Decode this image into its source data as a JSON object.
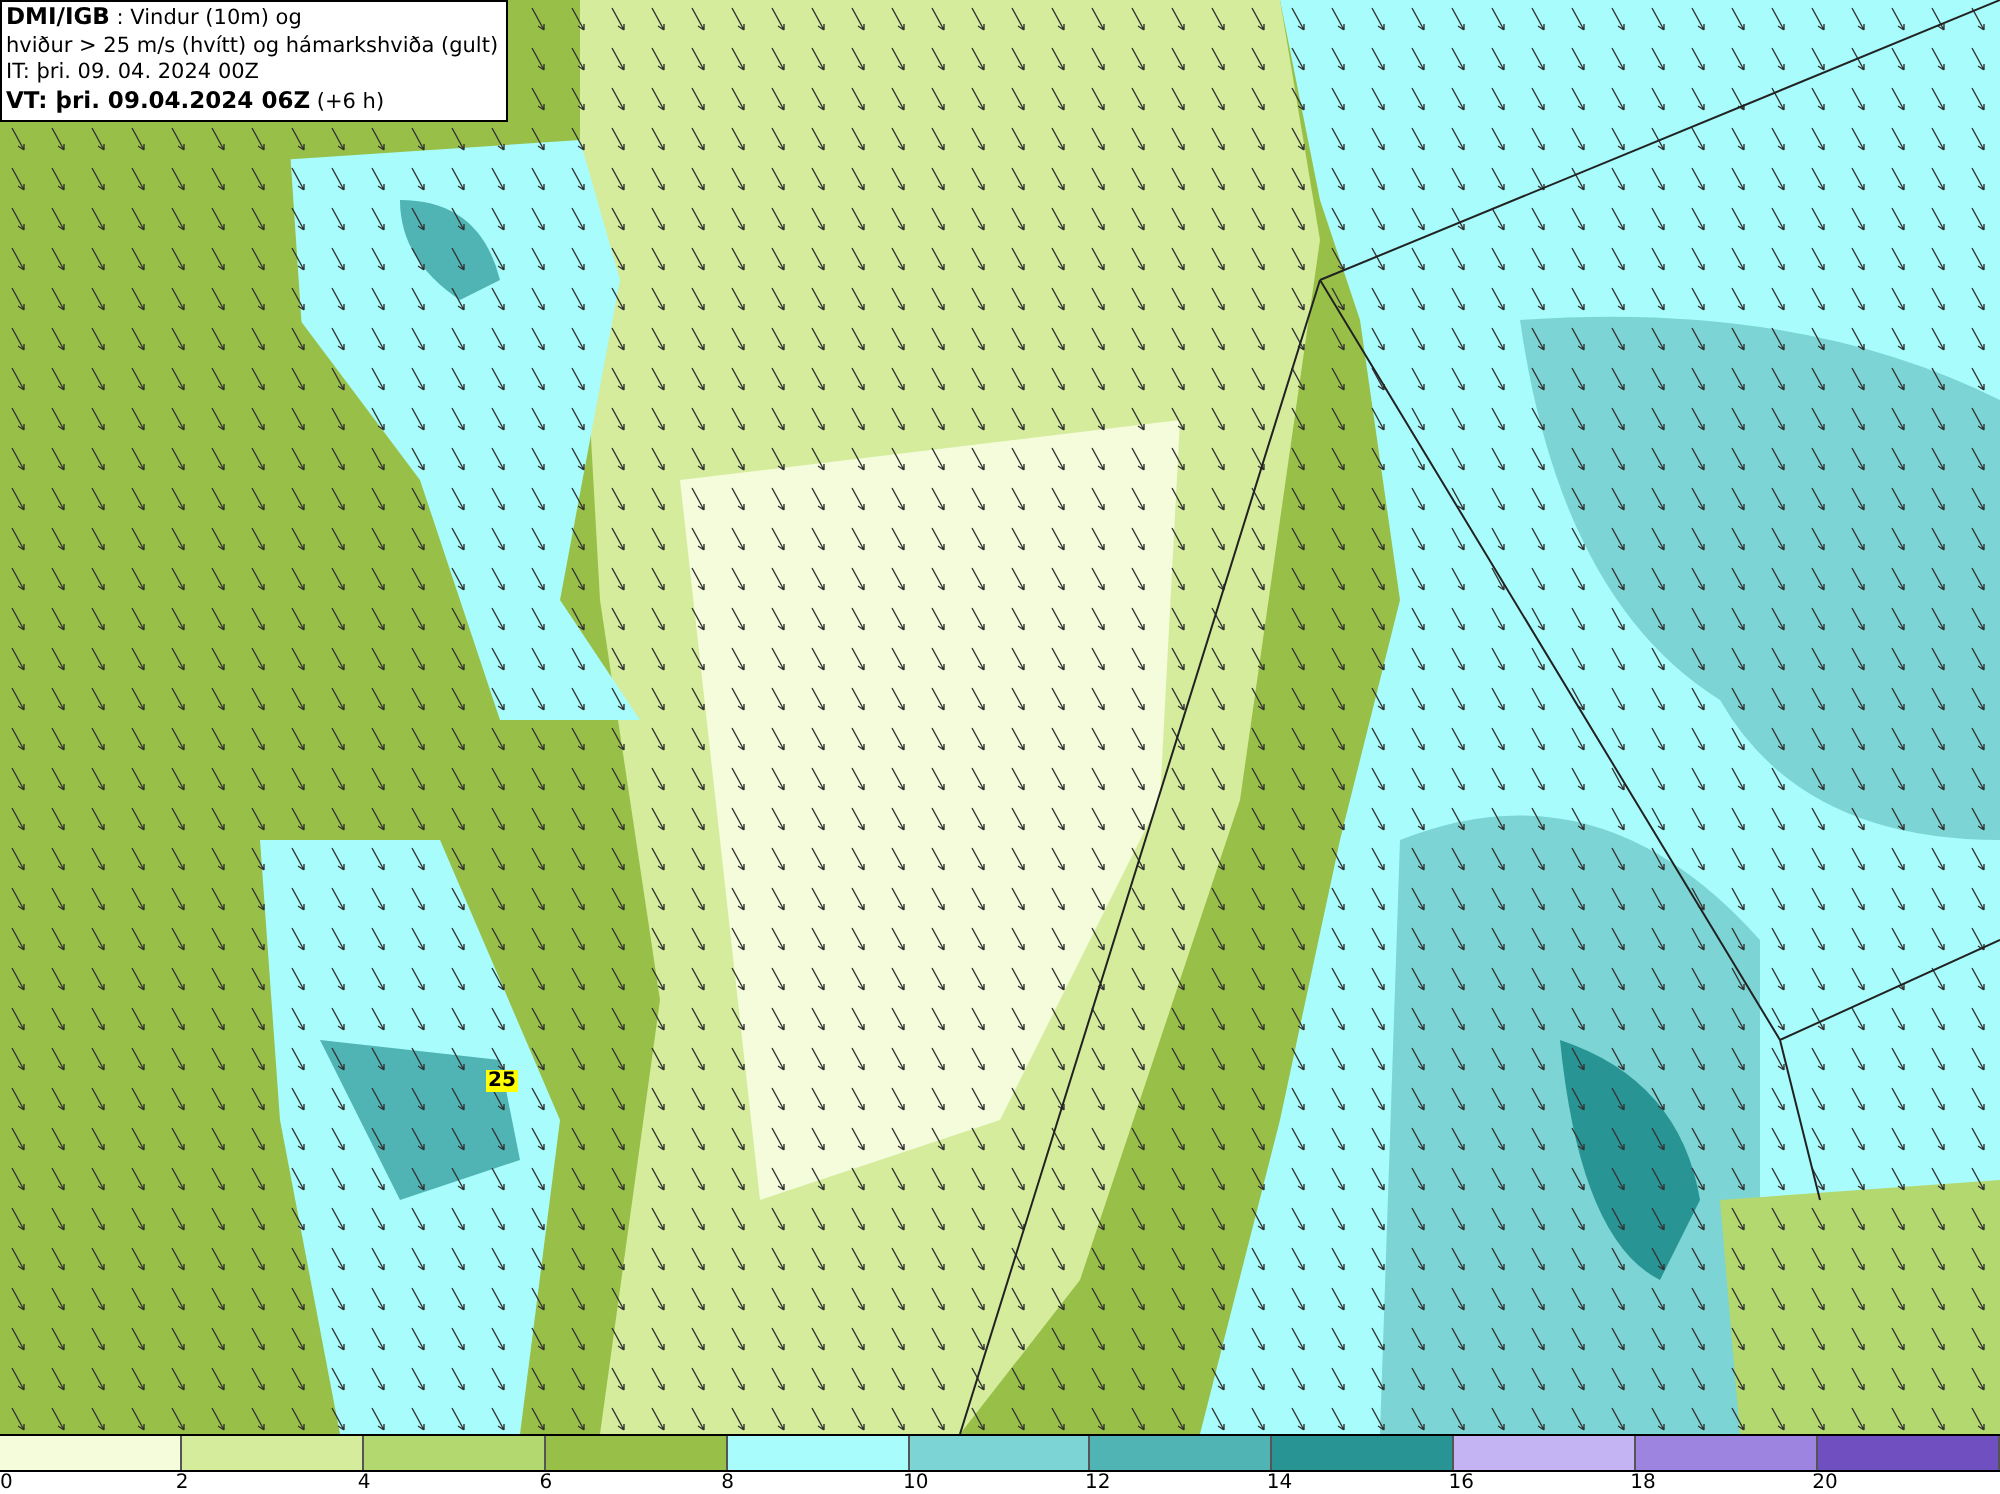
{
  "info": {
    "lines": [
      "**DMI/IGB** : Vindur (10m) og",
      "hviður > 25 m/s (hvítt) og hámarkshviða (gult)",
      "IT: þri. 09. 04. 2024 00Z",
      "**VT: þri. 09.04.2024 06Z** (+6 h)"
    ]
  },
  "map": {
    "gust_labels": [
      {
        "text": "25"
      }
    ]
  },
  "legend": {
    "bins": [
      {
        "color": "#f5fcdc"
      },
      {
        "color": "#d4ec9c"
      },
      {
        "color": "#b4d870"
      },
      {
        "color": "#98c048"
      },
      {
        "color": "#a8fcfc"
      },
      {
        "color": "#7cd4d4"
      },
      {
        "color": "#50b4b4"
      },
      {
        "color": "#289494"
      },
      {
        "color": "#c4b4f4"
      },
      {
        "color": "#9c84e0"
      },
      {
        "color": "#7050c0"
      }
    ],
    "ticks": [
      "0",
      "2",
      "4",
      "6",
      "8",
      "10",
      "12",
      "14",
      "16",
      "18",
      "20"
    ]
  }
}
